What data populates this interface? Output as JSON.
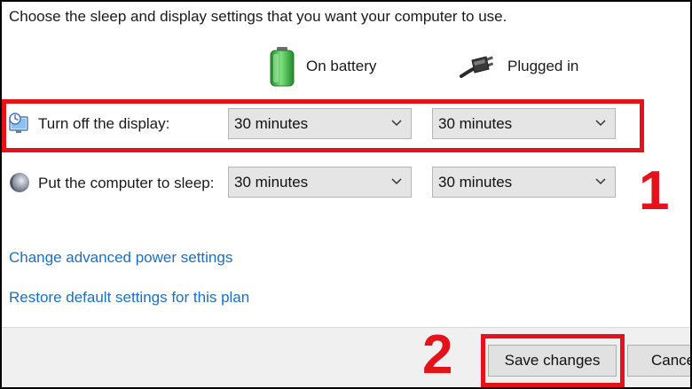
{
  "intro_text": "Choose the sleep and display settings that you want your computer to use.",
  "columns": {
    "on_battery": {
      "label": "On battery",
      "icon": "battery-icon"
    },
    "plugged_in": {
      "label": "Plugged in",
      "icon": "power-plug-icon"
    }
  },
  "rows": [
    {
      "label": "Turn off the display:",
      "icon": "display-icon",
      "on_battery_value": "30 minutes",
      "plugged_in_value": "30 minutes"
    },
    {
      "label": "Put the computer to sleep:",
      "icon": "sleep-moon-icon",
      "on_battery_value": "30 minutes",
      "plugged_in_value": "30 minutes"
    }
  ],
  "links": {
    "advanced": "Change advanced power settings",
    "restore": "Restore default settings for this plan"
  },
  "buttons": {
    "save": "Save changes",
    "cancel": "Cancel"
  },
  "annotations": {
    "step1": "1",
    "step2": "2",
    "highlight_color": "#e3121b"
  },
  "colors": {
    "link": "#1c6fc2",
    "battery_green": "#3cb043"
  }
}
